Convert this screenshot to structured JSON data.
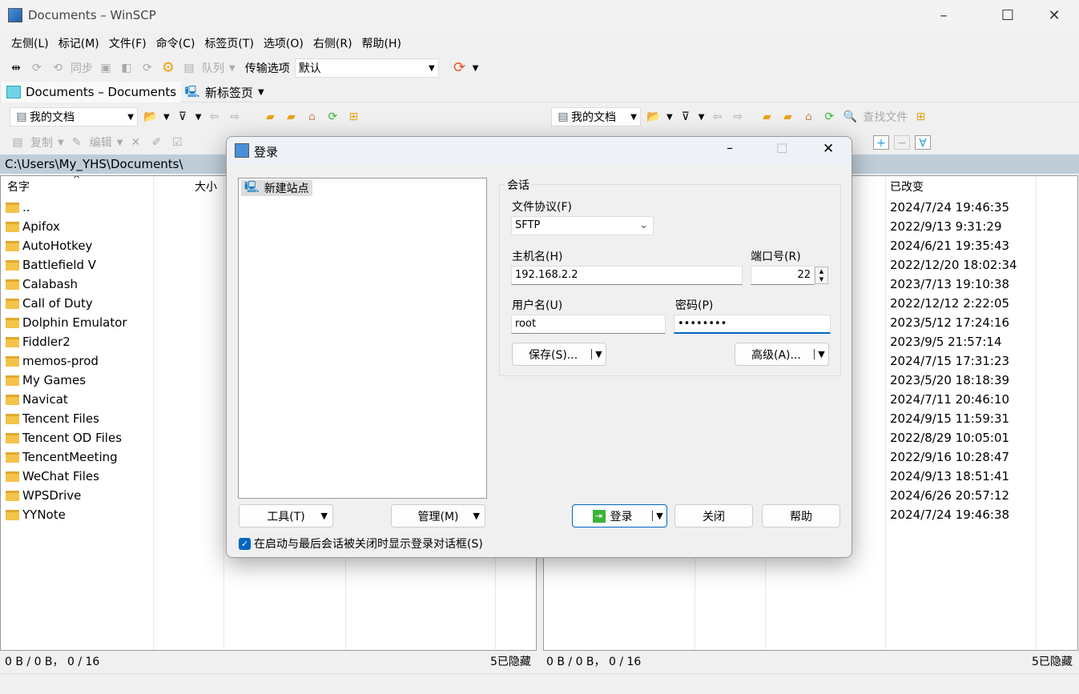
{
  "window": {
    "title": "Documents – WinSCP"
  },
  "menu": [
    "左侧(L)",
    "标记(M)",
    "文件(F)",
    "命令(C)",
    "标签页(T)",
    "选项(O)",
    "右侧(R)",
    "帮助(H)"
  ],
  "toolbar": {
    "sync": "同步",
    "queue": "队列",
    "transfer_label": "传输选项",
    "transfer_value": "默认"
  },
  "tabs": [
    {
      "label": "Documents – Documents"
    },
    {
      "label": "新标签页"
    }
  ],
  "left_panel": {
    "location": "我的文档",
    "copy": "复制",
    "edit": "编辑",
    "props": "属性",
    "path": "C:\\Users\\My_YHS\\Documents\\",
    "col_name": "名字",
    "col_size": "大小",
    "status_left": "0 B / 0 B，  0 / 16",
    "status_right": "5已隐藏"
  },
  "right_panel": {
    "location": "我的文档",
    "find": "查找文件",
    "col_changed": "已改变",
    "status_left": "0 B / 0 B，  0 / 16",
    "status_right": "5已隐藏"
  },
  "files": [
    {
      "name": "..",
      "left_date": "",
      "right_date": "2024/7/24 19:46:35",
      "up": true
    },
    {
      "name": "Apifox",
      "right_date": "2022/9/13 9:31:29"
    },
    {
      "name": "AutoHotkey",
      "right_date": "2024/6/21 19:35:43"
    },
    {
      "name": "Battlefield V",
      "right_date": "2022/12/20 18:02:34"
    },
    {
      "name": "Calabash",
      "right_date": "2023/7/13 19:10:38"
    },
    {
      "name": "Call of Duty",
      "right_date": "2022/12/12 2:22:05"
    },
    {
      "name": "Dolphin Emulator",
      "right_date": "2023/5/12 17:24:16"
    },
    {
      "name": "Fiddler2",
      "right_date": "2023/9/5 21:57:14"
    },
    {
      "name": "memos-prod",
      "right_date": "2024/7/15 17:31:23"
    },
    {
      "name": "My Games",
      "right_date": "2023/5/20 18:18:39"
    },
    {
      "name": "Navicat",
      "right_date": "2024/7/11 20:46:10"
    },
    {
      "name": "Tencent Files",
      "right_date": "2024/9/15 11:59:31"
    },
    {
      "name": "Tencent OD Files",
      "right_date": "2022/8/29 10:05:01"
    },
    {
      "name": "TencentMeeting",
      "right_date": "2022/9/16 10:28:47"
    },
    {
      "name": "WeChat Files",
      "right_date": "2024/9/13 18:51:41"
    },
    {
      "name": "WPSDrive",
      "right_date": "2024/6/26 20:57:12"
    },
    {
      "name": "YYNote",
      "right_date": "2024/7/24 19:46:38"
    }
  ],
  "dialog": {
    "title": "登录",
    "site": "新建站点",
    "group": "会话",
    "protocol_label": "文件协议(F)",
    "protocol": "SFTP",
    "host_label": "主机名(H)",
    "host": "192.168.2.2",
    "port_label": "端口号(R)",
    "port": "22",
    "user_label": "用户名(U)",
    "user": "root",
    "pass_label": "密码(P)",
    "pass": "••••••••",
    "save": "保存(S)...",
    "advanced": "高级(A)...",
    "tools": "工具(T)",
    "manage": "管理(M)",
    "login": "登录",
    "close": "关闭",
    "help": "帮助",
    "show_checkbox": "在启动与最后会话被关闭时显示登录对话框(S)",
    "show_checked": true
  }
}
